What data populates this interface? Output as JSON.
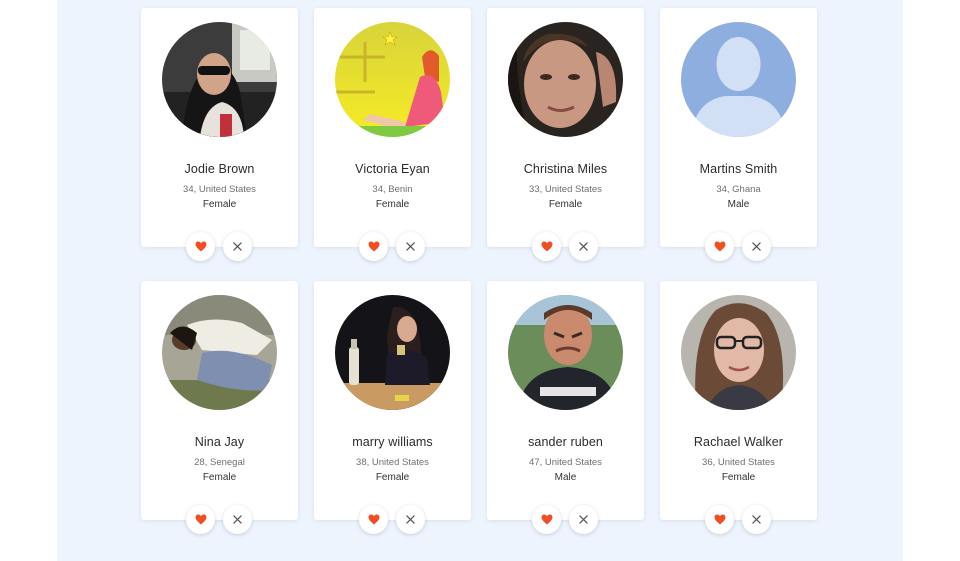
{
  "profiles": [
    {
      "name": "Jodie Brown",
      "meta": "34, United States",
      "gender": "Female",
      "avatar": "photo-woman-in-car"
    },
    {
      "name": "Victoria Eyan",
      "meta": "34, Benin",
      "gender": "Female",
      "avatar": "illustration-woman-pink-dress"
    },
    {
      "name": "Christina Miles",
      "meta": "33, United States",
      "gender": "Female",
      "avatar": "photo-woman-closeup"
    },
    {
      "name": "Martins Smith",
      "meta": "34, Ghana",
      "gender": "Male",
      "avatar": "default-avatar-silhouette"
    },
    {
      "name": "Nina Jay",
      "meta": "28, Senegal",
      "gender": "Female",
      "avatar": "photo-woman-rotated"
    },
    {
      "name": "marry williams",
      "meta": "38, United States",
      "gender": "Female",
      "avatar": "photo-woman-at-bar"
    },
    {
      "name": "sander ruben",
      "meta": "47, United States",
      "gender": "Male",
      "avatar": "photo-man-grimacing"
    },
    {
      "name": "Rachael Walker",
      "meta": "36, United States",
      "gender": "Female",
      "avatar": "photo-woman-glasses"
    }
  ],
  "icons": {
    "like": "heart-icon",
    "dismiss": "close-icon"
  },
  "colors": {
    "background": "#eef4fd",
    "card": "#ffffff",
    "accent": "#f04e23",
    "close": "#555555"
  }
}
